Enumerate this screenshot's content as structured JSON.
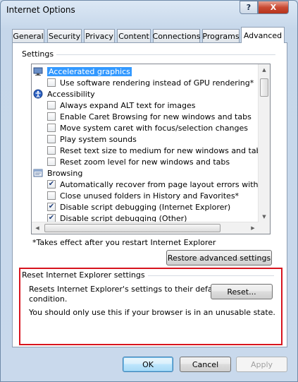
{
  "window": {
    "title": "Internet Options",
    "help_label": "?",
    "close_label": "X"
  },
  "tabs": [
    "General",
    "Security",
    "Privacy",
    "Content",
    "Connections",
    "Programs",
    "Advanced"
  ],
  "settings_group": {
    "label": "Settings",
    "items": [
      {
        "type": "category",
        "icon": "display-icon",
        "label": "Accelerated graphics",
        "selected": true
      },
      {
        "type": "option",
        "checked": false,
        "label": "Use software rendering instead of GPU rendering*"
      },
      {
        "type": "category",
        "icon": "accessibility-icon",
        "label": "Accessibility"
      },
      {
        "type": "option",
        "checked": false,
        "label": "Always expand ALT text for images"
      },
      {
        "type": "option",
        "checked": false,
        "label": "Enable Caret Browsing for new windows and tabs"
      },
      {
        "type": "option",
        "checked": false,
        "label": "Move system caret with focus/selection changes"
      },
      {
        "type": "option",
        "checked": false,
        "label": "Play system sounds"
      },
      {
        "type": "option",
        "checked": false,
        "label": "Reset text size to medium for new windows and tabs"
      },
      {
        "type": "option",
        "checked": false,
        "label": "Reset zoom level for new windows and tabs"
      },
      {
        "type": "category",
        "icon": "browsing-icon",
        "label": "Browsing"
      },
      {
        "type": "option",
        "checked": true,
        "label": "Automatically recover from page layout errors with Compa"
      },
      {
        "type": "option",
        "checked": false,
        "label": "Close unused folders in History and Favorites*"
      },
      {
        "type": "option",
        "checked": true,
        "label": "Disable script debugging (Internet Explorer)"
      },
      {
        "type": "option",
        "checked": true,
        "label": "Disable script debugging (Other)"
      }
    ],
    "footnote": "*Takes effect after you restart Internet Explorer",
    "restore_button": "Restore advanced settings"
  },
  "reset_group": {
    "label": "Reset Internet Explorer settings",
    "description_line1": "Resets Internet Explorer's settings to their default",
    "description_line2": "condition.",
    "warning": "You should only use this if your browser is in an unusable state.",
    "reset_button": "Reset..."
  },
  "footer": {
    "ok": "OK",
    "cancel": "Cancel",
    "apply": "Apply"
  },
  "colors": {
    "highlight": "#d7141e",
    "selection": "#3399ff"
  }
}
